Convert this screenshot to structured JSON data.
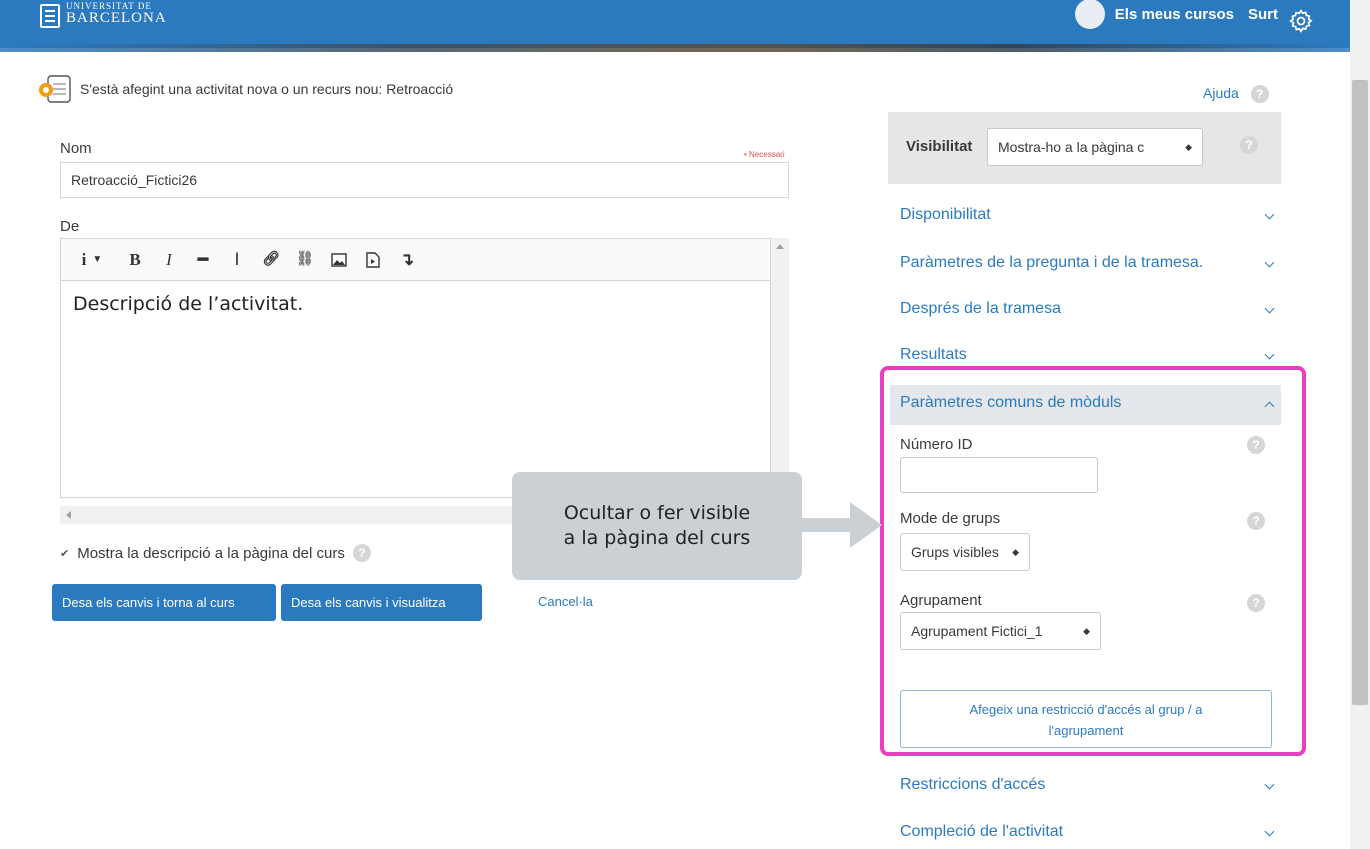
{
  "header": {
    "logo_line1": "UNIVERSITAT DE",
    "logo_line2": "BARCELONA",
    "my_courses": "Els meus cursos",
    "logout": "Surt"
  },
  "page": {
    "heading": "S'està afegint una activitat nova o un recurs nou: Retroacció",
    "help_label": "Ajuda"
  },
  "form": {
    "name_label": "Nom",
    "required_label": "Necessari",
    "name_value": "Retroacció_Ficticі26",
    "description_label": "De",
    "editor_text": "Descripció de l’activitat.",
    "show_description_label": "Mostra la descripció a la pàgina del curs",
    "save_return_label": "Desa els canvis i torna al curs",
    "save_view_label": "Desa els canvis i visualitza",
    "cancel_label": "Cancel·la"
  },
  "callout": {
    "line1": "Ocultar o fer visible",
    "line2": "a la pàgina del curs"
  },
  "sidebar": {
    "visibility_label": "Visibilitat",
    "visibility_value": "Mostra-ho a la pàgina c",
    "sections": [
      "Disponibilitat",
      "Paràmetres de la pregunta i de la tramesa.",
      "Després de la tramesa",
      "Resultats",
      "Paràmetres comuns de mòduls",
      "Restriccions d'accés",
      "Compleció de l'activitat"
    ],
    "id_number_label": "Número ID",
    "group_mode_label": "Mode de grups",
    "group_mode_value": "Grups visibles",
    "grouping_label": "Agrupament",
    "grouping_value": "Agrupament Fictici_1",
    "restriction_line1": "Afegeix una restricció d'accés al grup / a",
    "restriction_line2": "l'agrupament"
  },
  "colors": {
    "header_blue": "#2b7ac0",
    "link_blue": "#2b7ac0",
    "highlight_magenta": "#e83fc0",
    "callout_gray": "#cbd0d5"
  },
  "icons": [
    "gear-icon",
    "help-icon",
    "bold-icon",
    "italic-icon",
    "link-icon",
    "unlink-icon",
    "image-icon",
    "media-icon",
    "chevron-down-icon",
    "chevron-up-icon",
    "arrow-right-icon"
  ]
}
